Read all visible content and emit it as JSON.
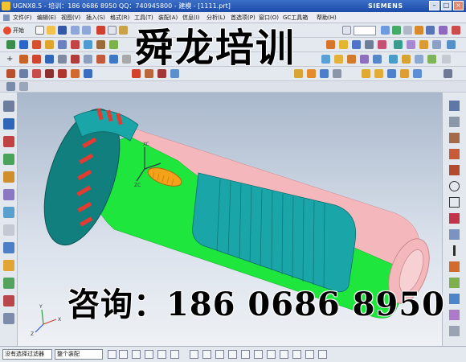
{
  "window": {
    "title": "UGNX8.5 - 培训：186 0686 8950 QQ：740945800 - 建模 - [1111.prt]",
    "brand": "SIEMENS"
  },
  "menu": [
    {
      "label": "文件(F)"
    },
    {
      "label": "编辑(E)"
    },
    {
      "label": "视图(V)"
    },
    {
      "label": "插入(S)"
    },
    {
      "label": "格式(R)"
    },
    {
      "label": "工具(T)"
    },
    {
      "label": "装配(A)"
    },
    {
      "label": "信息(I)"
    },
    {
      "label": "分析(L)"
    },
    {
      "label": "首选项(P)"
    },
    {
      "label": "窗口(O)"
    },
    {
      "label": "GC工具箱"
    },
    {
      "label": "帮助(H)"
    }
  ],
  "toolbar": {
    "start_label": "开始"
  },
  "watermark": {
    "title": "舜龙培训",
    "consult": "咨询：186 0686 8950"
  },
  "viewport": {
    "axis_labels": {
      "xc": "XC",
      "zc": "ZC",
      "x": "X",
      "y": "Y",
      "z": "Z"
    }
  },
  "statusbar": {
    "filter_label": "没有选择过滤器",
    "assembly_label": "整个装配"
  },
  "colors": {
    "body_green": "#1ee63c",
    "body_pink": "#f4b8bc",
    "grip_teal": "#1aa6a8",
    "head_teal": "#117f7d",
    "switch_orange": "#f5a21a",
    "stripe_red": "#e33a32"
  }
}
